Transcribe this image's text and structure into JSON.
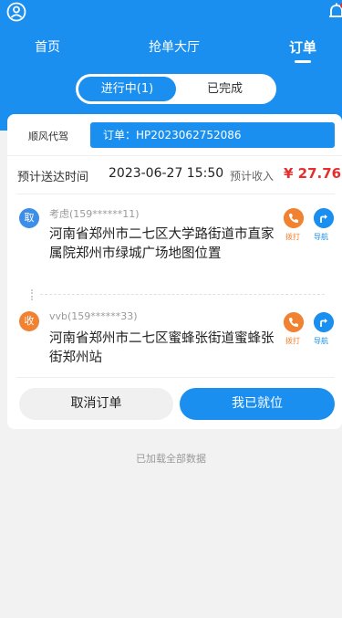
{
  "header": {
    "tabs": [
      {
        "label": "首页",
        "active": false
      },
      {
        "label": "抢单大厅",
        "active": false
      },
      {
        "label": "订单",
        "active": true
      }
    ],
    "user_icon": "user-circle-icon",
    "bell_icon": "bell-icon",
    "accent_color": "#1a8ff0"
  },
  "segments": {
    "in_progress": "进行中(1)",
    "completed": "已完成"
  },
  "order": {
    "service_type": "顺风代驾",
    "order_no": "订单：HP2023062752086",
    "eta_label": "预计送达时间",
    "eta_value": "2023-06-27 15:50",
    "income_label": "预计收入",
    "income_value": "¥ 27.76",
    "pickup": {
      "badge": "取",
      "contact": "考虑(159******11)",
      "address": "河南省郑州市二七区大学路街道市直家属院郑州市绿城广场地图位置",
      "call_label": "拨打",
      "nav_label": "导航"
    },
    "dropoff": {
      "badge": "收",
      "contact": "vvb(159******33)",
      "address": "河南省郑州市二七区蜜蜂张街道蜜蜂张街郑州站",
      "call_label": "拨打",
      "nav_label": "导航"
    },
    "cancel_label": "取消订单",
    "arrive_label": "我已就位"
  },
  "footer": {
    "status_text": "已加载全部数据"
  }
}
